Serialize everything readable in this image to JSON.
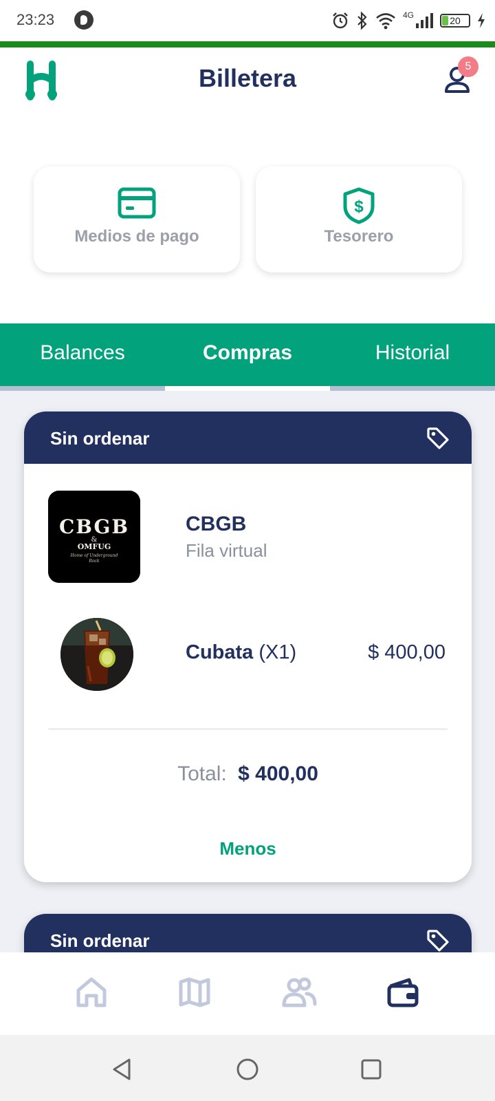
{
  "status_bar": {
    "time": "23:23",
    "network": "4G",
    "battery": "20"
  },
  "header": {
    "title": "Billetera",
    "notification_count": "5"
  },
  "quick_actions": [
    {
      "label": "Medios de pago",
      "icon": "credit-card-icon"
    },
    {
      "label": "Tesorero",
      "icon": "shield-dollar-icon"
    }
  ],
  "tabs": [
    {
      "label": "Balances",
      "active": false
    },
    {
      "label": "Compras",
      "active": true
    },
    {
      "label": "Historial",
      "active": false
    }
  ],
  "orders": [
    {
      "header": "Sin ordenar",
      "venue": {
        "name": "CBGB",
        "subtitle": "Fila virtual",
        "logo_text": "CBGB",
        "logo_amp": "&",
        "logo_sub": "OMFUG",
        "logo_tagline": "Home of Underground",
        "logo_tagline2": "Rock"
      },
      "items": [
        {
          "name": "Cubata",
          "quantity": "(X1)",
          "price": "$ 400,00"
        }
      ],
      "total_label": "Total:",
      "total_value": "$ 400,00",
      "toggle_label": "Menos"
    },
    {
      "header": "Sin ordenar"
    }
  ],
  "bottom_nav": [
    {
      "icon": "home-icon",
      "active": false
    },
    {
      "icon": "map-icon",
      "active": false
    },
    {
      "icon": "people-icon",
      "active": false
    },
    {
      "icon": "wallet-icon",
      "active": true
    }
  ],
  "colors": {
    "primary_navy": "#22305f",
    "accent_green": "#02a37c",
    "badge_pink": "#f27d86",
    "muted_text": "#8a909b"
  }
}
